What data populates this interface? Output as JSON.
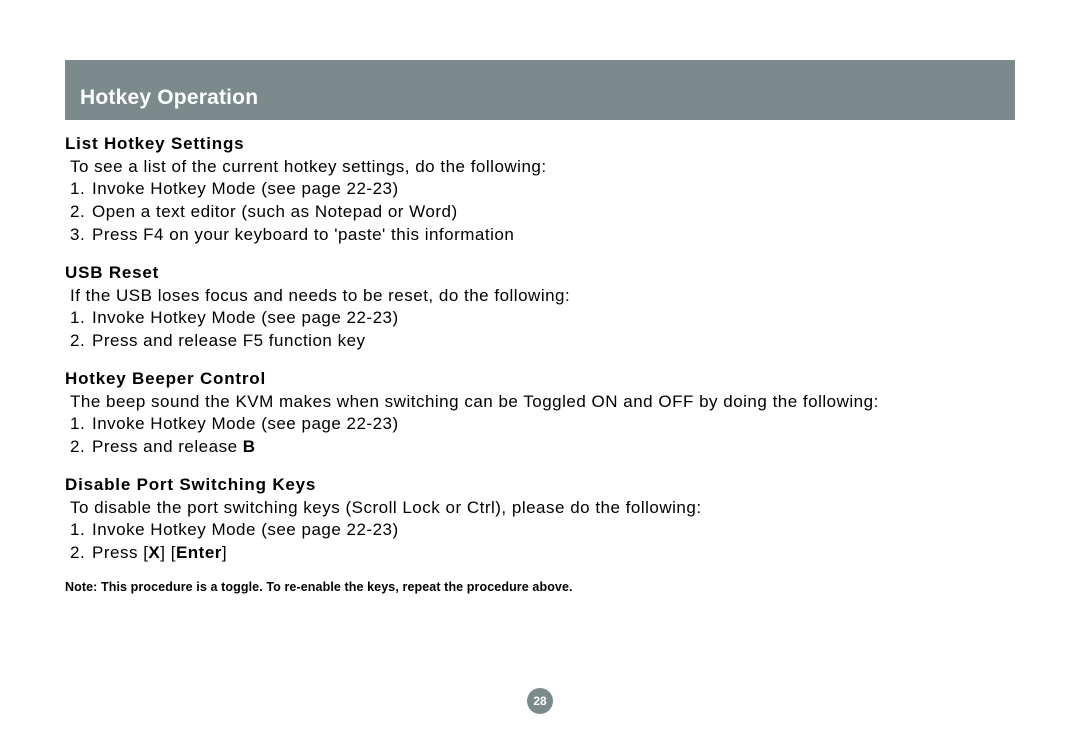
{
  "header": {
    "title": "Hotkey Operation"
  },
  "sections": {
    "list_hotkey": {
      "heading": "List Hotkey Settings",
      "intro": "To see a list of the current hotkey settings, do the following:",
      "steps": [
        "Invoke Hotkey Mode (see page 22-23)",
        "Open a text editor (such as Notepad or Word)",
        "Press F4 on your keyboard to 'paste' this information"
      ]
    },
    "usb_reset": {
      "heading": "USB Reset",
      "intro": "If the USB loses focus and needs to be reset, do the following:",
      "steps": [
        "Invoke Hotkey Mode (see page 22-23)",
        "Press and release F5 function key"
      ]
    },
    "beeper": {
      "heading": "Hotkey Beeper Control",
      "intro": "The beep sound the KVM makes when switching can be Toggled ON and OFF by doing the following:",
      "steps": [
        "Invoke Hotkey Mode (see page 22-23)",
        "Press and release "
      ],
      "step2_bold": "B"
    },
    "disable_port": {
      "heading": "Disable Port Switching Keys",
      "intro": "To disable the port switching keys (Scroll Lock or Ctrl), please do the following:",
      "steps": [
        "Invoke Hotkey Mode (see page 22-23)",
        "Press "
      ],
      "step2_key1": "[X]",
      "step2_key2": "[Enter]"
    }
  },
  "note": "Note: This procedure is a toggle. To re-enable the keys, repeat the procedure above.",
  "page_number": "28"
}
